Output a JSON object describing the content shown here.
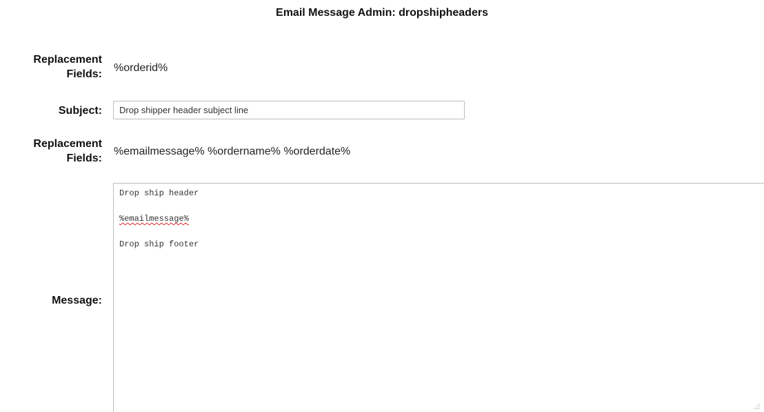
{
  "page": {
    "title": "Email Message Admin: dropshipheaders"
  },
  "form": {
    "replacement1": {
      "label_line1": "Replacement",
      "label_line2": "Fields:",
      "value": "%orderid%"
    },
    "subject": {
      "label": "Subject:",
      "value": "Drop shipper header subject line"
    },
    "replacement2": {
      "label_line1": "Replacement",
      "label_line2": "Fields:",
      "value": "%emailmessage% %ordername% %orderdate%"
    },
    "message": {
      "label": "Message:",
      "lines": [
        "Drop ship header",
        "%emailmessage%",
        "Drop ship footer"
      ]
    }
  }
}
